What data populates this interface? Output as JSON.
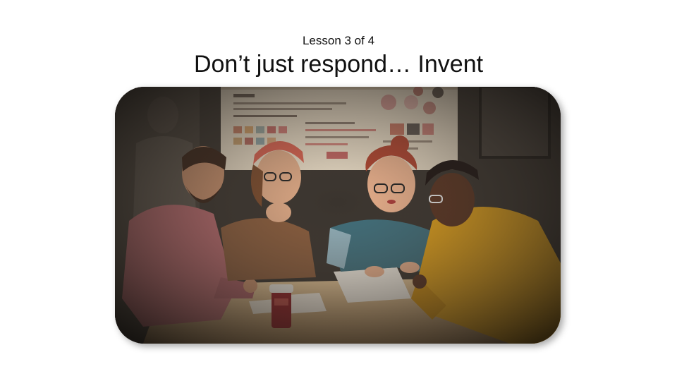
{
  "slide": {
    "subtitle": "Lesson 3 of 4",
    "title": "Don’t just respond… Invent"
  },
  "illustration": {
    "subject": "four people around a table",
    "colors": {
      "background": "#2a2622",
      "board": "#e9dcc6",
      "table": "#d9b98a",
      "shirt_pink": "#b96a6e",
      "shirt_brown": "#8a5c3c",
      "shirt_teal": "#3f6f7c",
      "shirt_yellow": "#e3a21a"
    }
  }
}
